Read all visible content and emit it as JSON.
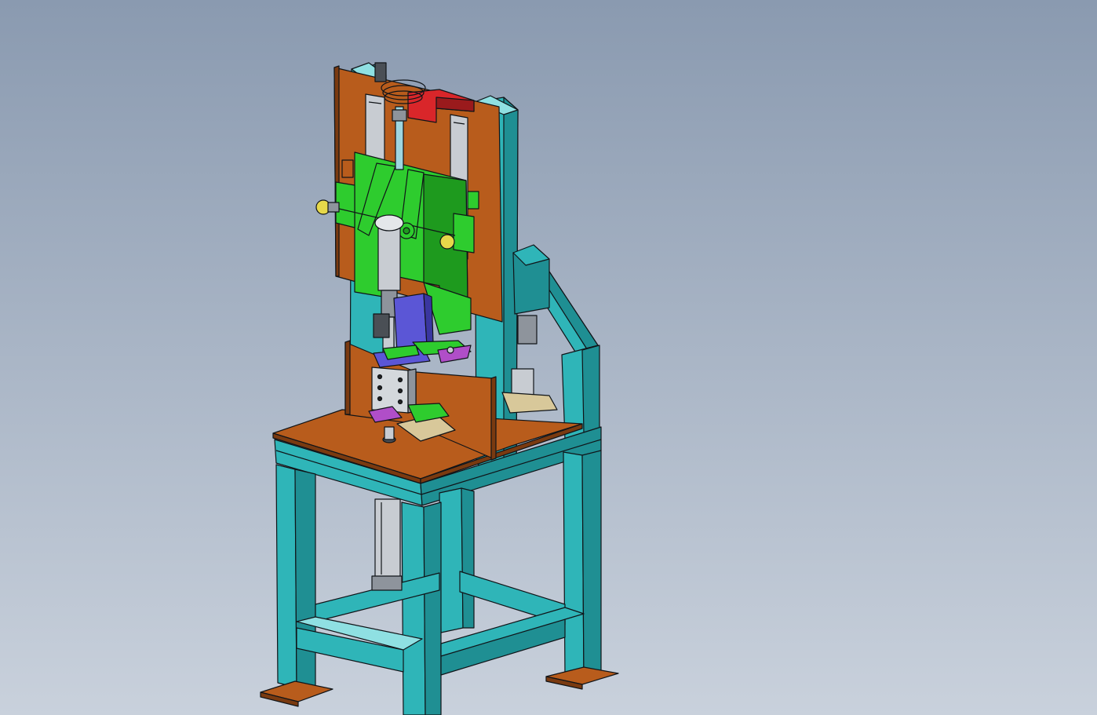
{
  "viewport": {
    "background_top": "#8a9ab0",
    "background_bottom": "#c9d1dc"
  },
  "colors": {
    "frame": "#2fb5b8",
    "frame_dark": "#1f8f93",
    "frame_shade": "#178084",
    "plate": "#b85c1c",
    "plate_side": "#7a3a10",
    "green_plate": "#2ecc2e",
    "green_dark": "#1e9a1e",
    "red_bracket": "#d9262a",
    "purple": "#5b56d6",
    "magenta": "#b04ec8",
    "knob": "#e6d84a",
    "steel": "#c8ccd2",
    "steel_dark": "#8e949c",
    "tan": "#d8c89a"
  }
}
